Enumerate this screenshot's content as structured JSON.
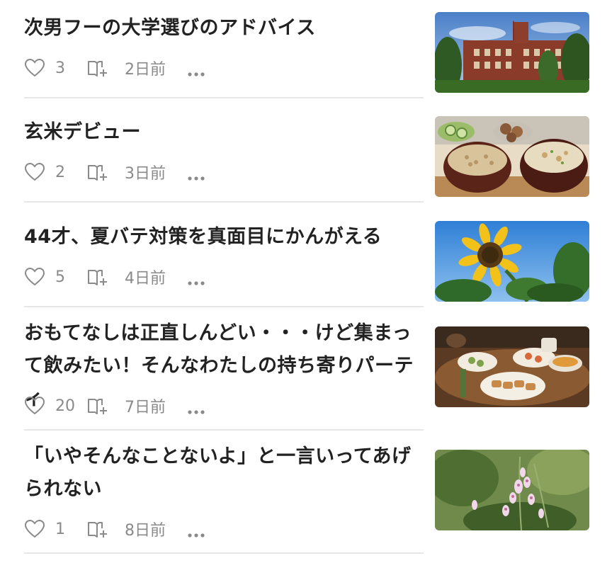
{
  "articles": [
    {
      "title": "次男フーの大学選びのアドバイス",
      "likes": "3",
      "date": "2日前",
      "thumbnail": "university-building-image"
    },
    {
      "title": "玄米デビュー",
      "likes": "2",
      "date": "3日前",
      "thumbnail": "brown-rice-meal-image"
    },
    {
      "title": "44才、夏バテ対策を真面目にかんがえる",
      "likes": "5",
      "date": "4日前",
      "thumbnail": "sunflower-image"
    },
    {
      "title": "おもてなしは正直しんどい・・・けど集まって飲みたい！そんなわたしの持ち寄りパーティ",
      "likes": "20",
      "date": "7日前",
      "thumbnail": "party-food-image"
    },
    {
      "title": "「いやそんなことないよ」と一言いってあげられない",
      "likes": "1",
      "date": "8日前",
      "thumbnail": "pink-flowers-image"
    }
  ],
  "colors": {
    "text": "#222222",
    "meta": "#8a8a8a",
    "divider": "#e6e6e6"
  },
  "icons": {
    "like": "heart-outline-icon",
    "bookmark": "magazine-add-icon",
    "more": "ellipsis-icon"
  }
}
